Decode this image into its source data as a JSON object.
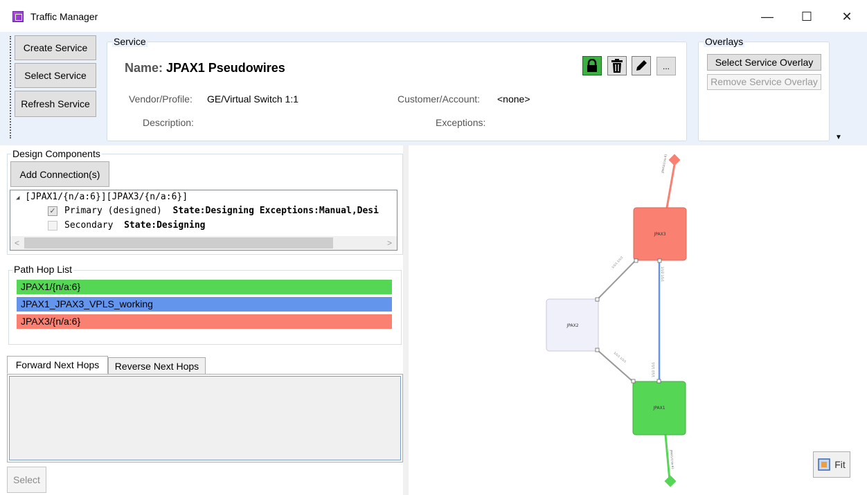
{
  "window": {
    "title": "Traffic Manager"
  },
  "toolbar": {
    "create_service": "Create Service",
    "select_service": "Select Service",
    "refresh_service": "Refresh Service"
  },
  "service": {
    "group_title": "Service",
    "name_label": "Name:",
    "name_value": "JPAX1 Pseudowires",
    "vendor_label": "Vendor/Profile:",
    "vendor_value": "GE/Virtual Switch 1:1",
    "customer_label": "Customer/Account:",
    "customer_value": "<none>",
    "description_label": "Description:",
    "exceptions_label": "Exceptions:",
    "more_button": "..."
  },
  "overlays": {
    "group_title": "Overlays",
    "select_overlay": "Select Service Overlay",
    "remove_overlay": "Remove Service Overlay"
  },
  "design": {
    "group_title": "Design Components",
    "add_connection": "Add Connection(s)",
    "tree_root": "[JPAX1/{n/a:6}][JPAX3/{n/a:6}]",
    "primary_label": "Primary (designed)",
    "primary_detail": "State:Designing Exceptions:Manual,Desi",
    "primary_checked": true,
    "secondary_label": "Secondary",
    "secondary_detail": "State:Designing",
    "secondary_checked": false
  },
  "path_hops": {
    "group_title": "Path Hop List",
    "items": [
      {
        "label": "JPAX1/{n/a:6}",
        "color": "#55d655"
      },
      {
        "label": "JPAX1_JPAX3_VPLS_working",
        "color": "#6495ed"
      },
      {
        "label": "JPAX3/{n/a:6}",
        "color": "#fa8072"
      }
    ]
  },
  "tabs": {
    "forward": "Forward Next Hops",
    "reverse": "Reverse Next Hops",
    "active": "forward"
  },
  "select_button": "Select",
  "graph": {
    "nodes": [
      {
        "label": "JPAX3",
        "color": "#fa8072"
      },
      {
        "label": "JPAX2",
        "color": "#f0f0fa"
      },
      {
        "label": "JPAX1",
        "color": "#55d655"
      }
    ],
    "fit_button": "Fit"
  }
}
